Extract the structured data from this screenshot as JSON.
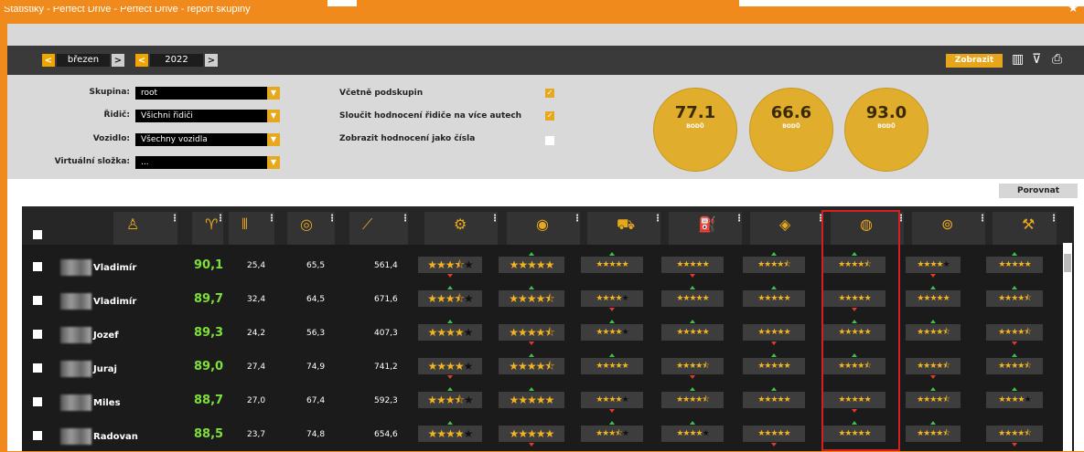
{
  "window": {
    "title": "Statistiky - Perfect Drive - Perfect Drive - report skupiny",
    "star_icon": "star-icon"
  },
  "toolbar": {
    "month": "březen",
    "year": "2022",
    "prev_glyph": "<",
    "next_glyph": ">",
    "show_button": "Zobrazit",
    "icons": [
      "book-icon",
      "trophy-icon",
      "print-icon"
    ]
  },
  "filters": {
    "group_label": "Skupina:",
    "group_value": "root",
    "driver_label": "Řidič:",
    "driver_value": "Všichni řidiči",
    "vehicle_label": "Vozidlo:",
    "vehicle_value": "Všechny vozidla",
    "folder_label": "Virtuální složka:",
    "folder_value": "...",
    "include_subgroups_label": "Včetně podskupin",
    "include_subgroups": true,
    "merge_label": "Sloučit hodnocení řidiče na více autech",
    "merge": true,
    "numbers_label": "Zobrazit hodnocení jako čísla",
    "numbers": false
  },
  "badges": [
    {
      "value": "77.1",
      "unit": "BODŮ"
    },
    {
      "value": "66.6",
      "unit": "BODŮ"
    },
    {
      "value": "93.0",
      "unit": "BODŮ"
    }
  ],
  "compare_button": "Porovnat",
  "columns": [
    "driver-icon",
    "trophy-icon",
    "road-icon",
    "speedometer-icon",
    "slope-icon",
    "gear-icon",
    "tire-icon",
    "truck-icon",
    "fuel-icon",
    "eye-icon",
    "brake-disc-icon",
    "steering-icon",
    "engine-icon"
  ],
  "rows": [
    {
      "name": "Vladimír",
      "score": "90,1",
      "c1": "25,4",
      "c2": "65,5",
      "c3": "561,4",
      "stars": [
        3.5,
        5,
        5,
        5,
        4.5,
        4.5,
        4,
        5
      ]
    },
    {
      "name": "Vladimír",
      "score": "89,7",
      "c1": "32,4",
      "c2": "64,5",
      "c3": "671,6",
      "stars": [
        3.5,
        4.5,
        4,
        5,
        5,
        5,
        5,
        4.5
      ]
    },
    {
      "name": "Jozef",
      "score": "89,3",
      "c1": "24,2",
      "c2": "56,3",
      "c3": "407,3",
      "stars": [
        4,
        4.5,
        4,
        5,
        5,
        5,
        4.5,
        4.5
      ]
    },
    {
      "name": "Juraj",
      "score": "89,0",
      "c1": "27,4",
      "c2": "74,9",
      "c3": "741,2",
      "stars": [
        4,
        4.5,
        5,
        4.5,
        5,
        4.5,
        4.5,
        4.5
      ]
    },
    {
      "name": "Miles",
      "score": "88,7",
      "c1": "27,0",
      "c2": "67,4",
      "c3": "592,3",
      "stars": [
        3.5,
        5,
        4,
        4.5,
        5,
        5,
        4.5,
        4
      ]
    },
    {
      "name": "Radovan",
      "score": "88,5",
      "c1": "23,7",
      "c2": "74,8",
      "c3": "654,6",
      "stars": [
        4,
        5,
        3.5,
        4,
        5,
        5,
        4.5,
        4.5
      ]
    }
  ]
}
